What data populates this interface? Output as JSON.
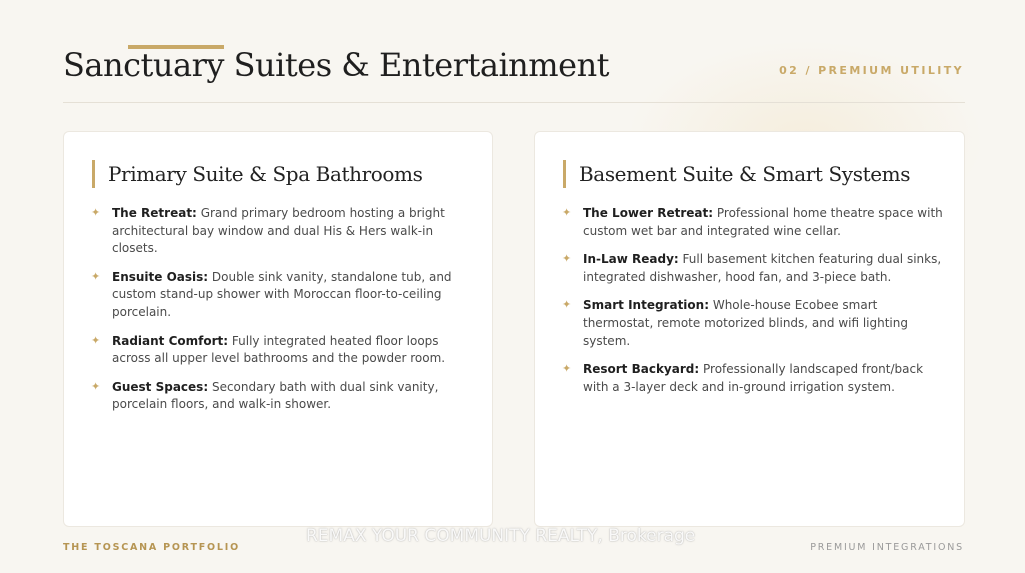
{
  "header": {
    "title": "Sanctuary Suites & Entertainment",
    "section_label": "02 / PREMIUM UTILITY"
  },
  "cards": [
    {
      "title": "Primary Suite & Spa Bathrooms",
      "items": [
        {
          "term": "The Retreat:",
          "text": "Grand primary bedroom hosting a bright architectural bay window and dual His & Hers walk-in closets."
        },
        {
          "term": "Ensuite Oasis:",
          "text": "Double sink vanity, standalone tub, and custom stand-up shower with Moroccan floor-to-ceiling porcelain."
        },
        {
          "term": "Radiant Comfort:",
          "text": "Fully integrated heated floor loops across all upper level bathrooms and the powder room."
        },
        {
          "term": "Guest Spaces:",
          "text": "Secondary bath with dual sink vanity, porcelain floors, and walk-in shower."
        }
      ]
    },
    {
      "title": "Basement Suite & Smart Systems",
      "items": [
        {
          "term": "The Lower Retreat:",
          "text": "Professional home theatre space with custom wet bar and integrated wine cellar."
        },
        {
          "term": "In-Law Ready:",
          "text": "Full basement kitchen featuring dual sinks, integrated dishwasher, hood fan, and 3-piece bath."
        },
        {
          "term": "Smart Integration:",
          "text": "Whole-house Ecobee smart thermostat, remote motorized blinds, and wifi lighting system."
        },
        {
          "term": "Resort Backyard:",
          "text": "Professionally landscaped front/back with a 3-layer deck and in-ground irrigation system."
        }
      ]
    }
  ],
  "bullet_glyph": "✦",
  "footer": {
    "left": "THE TOSCANA PORTFOLIO",
    "center": "REMAX YOUR COMMUNITY REALTY, Brokerage",
    "right": "PREMIUM INTEGRATIONS"
  },
  "colors": {
    "accent_gold": "#c9a968",
    "background": "#f8f6f1",
    "card": "#ffffff"
  }
}
